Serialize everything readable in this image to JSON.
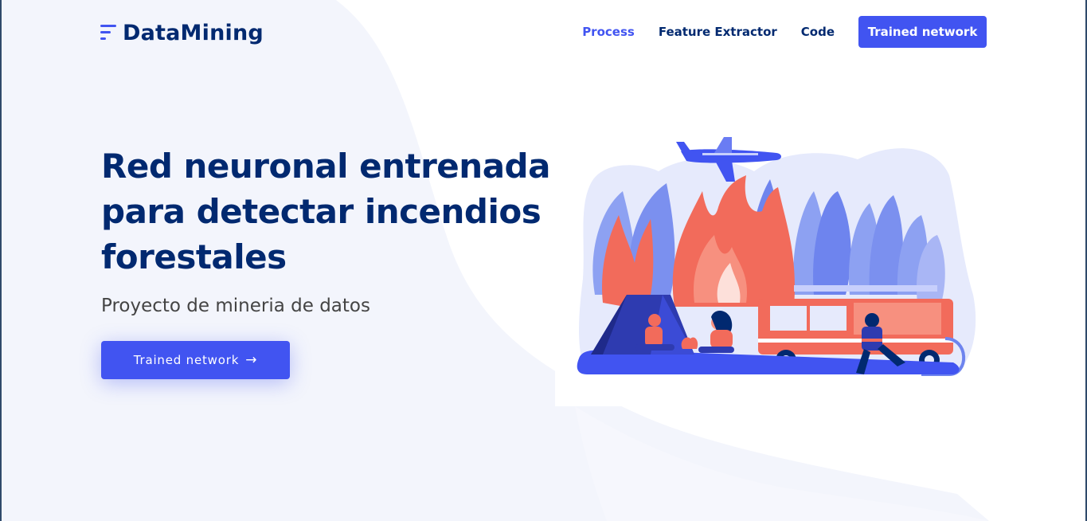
{
  "brand": {
    "name": "DataMining",
    "icon": "bars-menu-icon"
  },
  "nav": {
    "items": [
      {
        "label": "Process",
        "active": true
      },
      {
        "label": "Feature Extractor",
        "active": false
      },
      {
        "label": "Code",
        "active": false
      }
    ],
    "cta_label": "Trained network"
  },
  "hero": {
    "title": "Red neuronal entrenada para detectar incendios forestales",
    "subtitle": "Proyecto de mineria de datos",
    "button_label": "Trained network",
    "button_icon": "arrow-right-icon",
    "illustration": "forest-fire-illustration"
  },
  "colors": {
    "primary": "#4154f1",
    "heading": "#012970",
    "text": "#444444",
    "background_wave": "#f3f5fc",
    "fire": "#f26b5b",
    "foliage": "#8da1f2"
  }
}
